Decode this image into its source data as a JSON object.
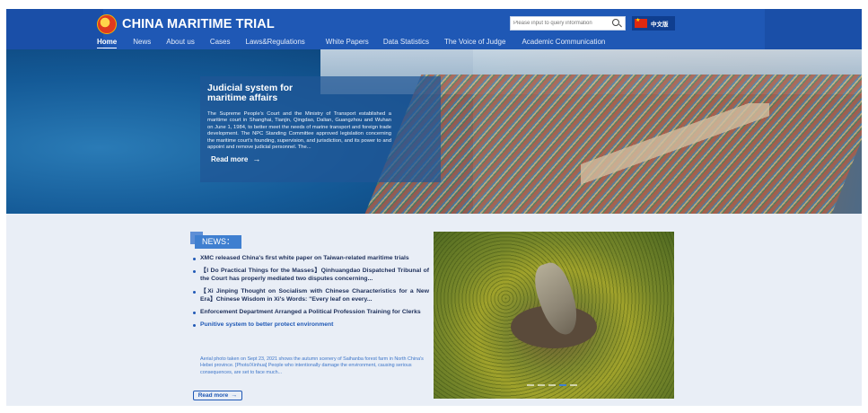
{
  "header": {
    "site_title": "CHINA MARITIME TRIAL",
    "search_placeholder": "Please input to query information",
    "language_label": "中文版",
    "nav": [
      {
        "label": "Home",
        "active": true
      },
      {
        "label": "News"
      },
      {
        "label": "About us"
      },
      {
        "label": "Cases"
      },
      {
        "label": "Laws&Regulations"
      },
      {
        "label": "White Papers"
      },
      {
        "label": "Data Statistics"
      },
      {
        "label": "The Voice of Judge"
      },
      {
        "label": "Academic Communication"
      }
    ],
    "icons": {
      "logo": "court-emblem-icon",
      "search": "search-icon",
      "flag": "china-flag-icon"
    }
  },
  "hero": {
    "title": "Judicial system for maritime affairs",
    "body": "The Supreme People's Court and the Ministry of Transport established a maritime court in Shanghai, Tianjin, Qingdao, Dalian, Guangzhou and Wuhan on June 1, 1984, to better meet the needs of marine transport and foreign trade development. The NPC Standing Committee approved legislation concerning the maritime court's founding, supervision, and jurisdiction, and its power to and appoint and remove judicial personnel. The...",
    "read_more": "Read more",
    "read_more_icon": "→"
  },
  "news": {
    "tag": "NEWS：",
    "items": [
      {
        "text": "XMC released China's first white paper on Taiwan-related maritime trials"
      },
      {
        "text": "【I Do Practical Things for the Masses】Qinhuangdao Dispatched Tribunal of the Court has properly mediated two disputes concerning..."
      },
      {
        "text": "【Xi Jinping Thought on Socialism with Chinese Characteristics for a New Era】Chinese Wisdom in Xi's Words: \"Every leaf on every..."
      },
      {
        "text": "Enforcement Department Arranged a Political Profession Training for Clerks"
      },
      {
        "text": "Punitive system to better protect environment",
        "highlight": true
      }
    ],
    "summary": "Aerial photo taken on Sept 23, 2021 shows the autumn scenery of Saihanba forest farm in North China's Hebei province. [Photo/Xinhua] People who intentionally damage the environment, causing serious consequences, are set to face much...",
    "read_more": "Read more",
    "read_more_icon": "→"
  },
  "photo": {
    "slides": 5,
    "active_slide": 4
  },
  "colors": {
    "header_bg": "#1a4fa8",
    "accent": "#1f58b5",
    "page_bg": "#e9eef6"
  }
}
